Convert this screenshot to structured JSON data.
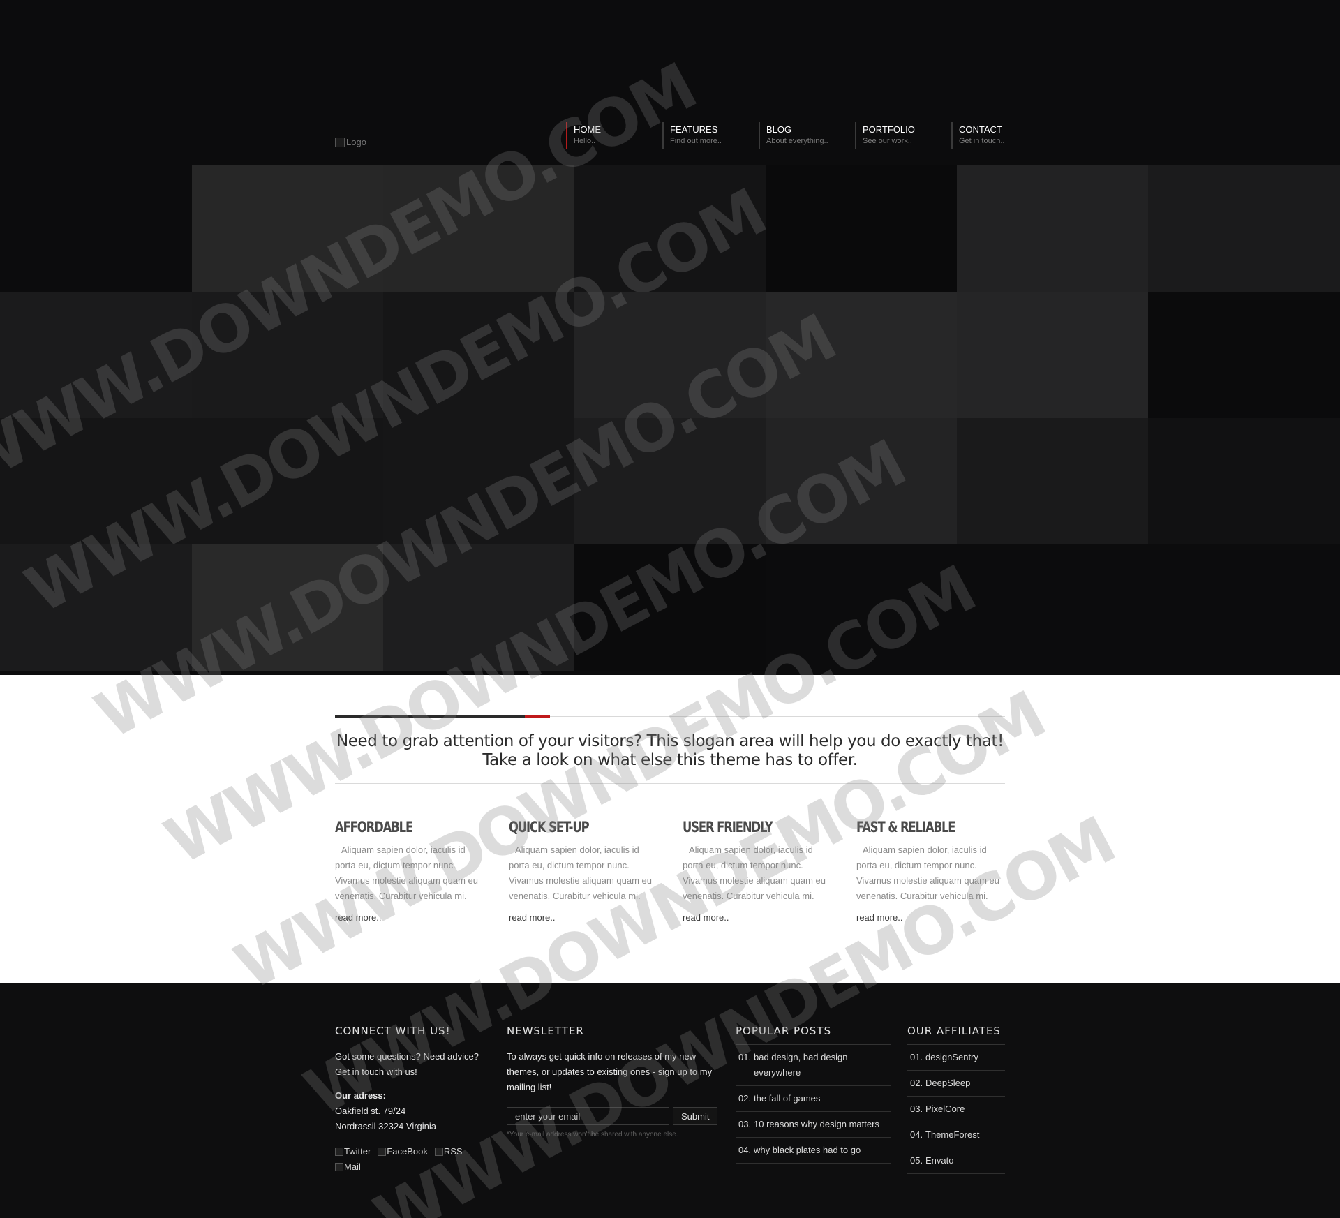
{
  "header": {
    "logo_alt": "Logo",
    "nav": [
      {
        "label": "HOME",
        "sub": "Hello.."
      },
      {
        "label": "FEATURES",
        "sub": "Find out more.."
      },
      {
        "label": "BLOG",
        "sub": "About everything.."
      },
      {
        "label": "PORTFOLIO",
        "sub": "See our work.."
      },
      {
        "label": "CONTACT",
        "sub": "Get in touch.."
      }
    ]
  },
  "slogan": {
    "line1": "Need to grab attention of your visitors? This slogan area will help you do exactly that!",
    "line2": "Take a look on what else this theme has to offer."
  },
  "features": [
    {
      "title": "AFFORDABLE",
      "text": "Aliquam sapien dolor, iaculis id porta eu, dictum tempor nunc. Vivamus molestie aliquam quam eu venenatis. Curabitur vehicula mi.",
      "link": "read more.."
    },
    {
      "title": "QUICK SET-UP",
      "text": "Aliquam sapien dolor, iaculis id porta eu, dictum tempor nunc. Vivamus molestie aliquam quam eu venenatis. Curabitur vehicula mi.",
      "link": "read more.."
    },
    {
      "title": "USER FRIENDLY",
      "text": "Aliquam sapien dolor, iaculis id porta eu, dictum tempor nunc. Vivamus molestie aliquam quam eu venenatis. Curabitur vehicula mi.",
      "link": "read more.."
    },
    {
      "title": "FAST & RELIABLE",
      "text": "Aliquam sapien dolor, iaculis id porta eu, dictum tempor nunc. Vivamus molestie aliquam quam eu venenatis. Curabitur vehicula mi.",
      "link": "read more.."
    }
  ],
  "footer": {
    "connect": {
      "title": "CONNECT WITH US!",
      "intro": "Got some questions? Need advice? Get in touch with us!",
      "address_label": "Our adress:",
      "address_line1": "Oakfield st. 79/24",
      "address_line2": "Nordrassil 32324 Virginia",
      "social": [
        "Twitter",
        "FaceBook",
        "RSS",
        "Mail"
      ]
    },
    "newsletter": {
      "title": "NEWSLETTER",
      "text": "To always get quick info on releases of my new themes, or updates to existing ones - sign up to my mailing list!",
      "placeholder": "enter your email",
      "button": "Submit",
      "note": "*Your e-mail address won't be shared with anyone else."
    },
    "popular": {
      "title": "POPULAR POSTS",
      "items": [
        {
          "num": "01.",
          "text": "bad design, bad design everywhere"
        },
        {
          "num": "02.",
          "text": "the fall of games"
        },
        {
          "num": "03.",
          "text": "10 reasons why design matters"
        },
        {
          "num": "04.",
          "text": "why black plates had to go"
        }
      ]
    },
    "affiliates": {
      "title": "OUR AFFILIATES",
      "items": [
        {
          "num": "01.",
          "text": "designSentry"
        },
        {
          "num": "02.",
          "text": "DeepSleep"
        },
        {
          "num": "03.",
          "text": "PixelCore"
        },
        {
          "num": "04.",
          "text": "ThemeForest"
        },
        {
          "num": "05.",
          "text": "Envato"
        }
      ]
    }
  },
  "colors": {
    "accent": "#c0191b",
    "background_dark": "#0c0c0d",
    "content_bg": "#ffffff"
  },
  "watermark": "WWW.DOWNDEMO.COM"
}
